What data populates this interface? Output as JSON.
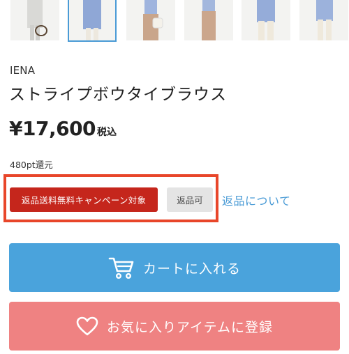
{
  "product": {
    "brand": "IENA",
    "name": "ストライプボウタイブラウス",
    "price": "¥17,600",
    "tax_label": "税込",
    "points": "480pt還元"
  },
  "badges": {
    "campaign": "返品送料無料キャンペーン対象",
    "returnable": "返品可"
  },
  "links": {
    "return_info": "返品について"
  },
  "actions": {
    "add_to_cart": "カートに入れる",
    "add_to_favorites": "お気に入りアイテムに登録"
  },
  "thumbnails": {
    "count": 6,
    "selected_index": 1
  },
  "colors": {
    "cart_button": "#4aa3dc",
    "favorite_button": "#ef8282",
    "campaign_badge": "#c5261c",
    "highlight_border": "#e8462a",
    "link": "#4a9bd6"
  },
  "icons": {
    "cart": "cart-icon",
    "favorite": "heart-icon"
  }
}
